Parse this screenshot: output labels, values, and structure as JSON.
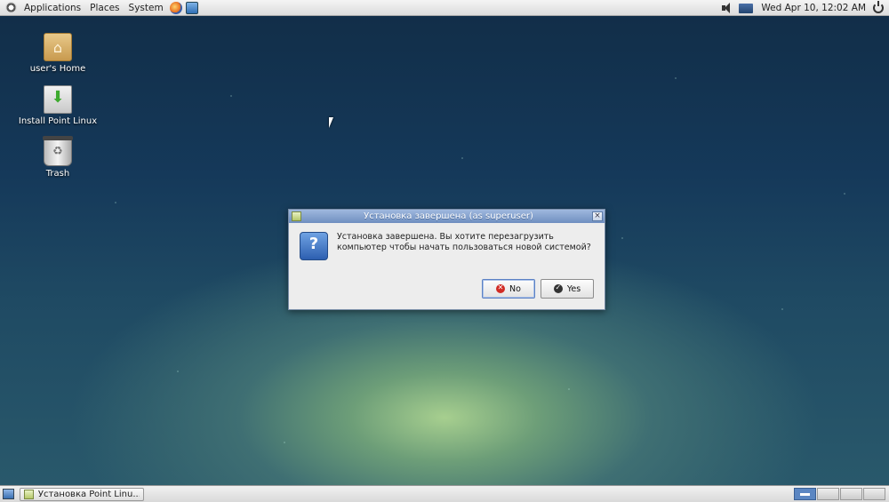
{
  "top_panel": {
    "menus": [
      "Applications",
      "Places",
      "System"
    ],
    "clock": "Wed Apr 10, 12:02 AM",
    "icons": [
      "distro-logo-icon",
      "firefox-icon",
      "app-launcher-icon",
      "volume-icon",
      "network-icon",
      "power-icon"
    ]
  },
  "desktop": {
    "icons": [
      {
        "label": "user's Home",
        "icon": "home-folder-icon"
      },
      {
        "label": "Install Point Linux",
        "icon": "installer-icon"
      },
      {
        "label": "Trash",
        "icon": "trash-icon"
      }
    ]
  },
  "dialog": {
    "title": "Установка завершена (as superuser)",
    "message_line1": "Установка завершена. Вы хотите перезагрузить",
    "message_line2": "компьютер чтобы начать пользоваться новой системой?",
    "icon": "question-icon",
    "buttons": {
      "no": "No",
      "yes": "Yes"
    },
    "close": "×"
  },
  "bottom_panel": {
    "task": "Установка Point Linu...",
    "workspaces": 4,
    "active_workspace": 1
  },
  "colors": {
    "titlebar": "#7f9fd0",
    "panel": "#e6e6e6",
    "no_icon": "#d12b24"
  }
}
